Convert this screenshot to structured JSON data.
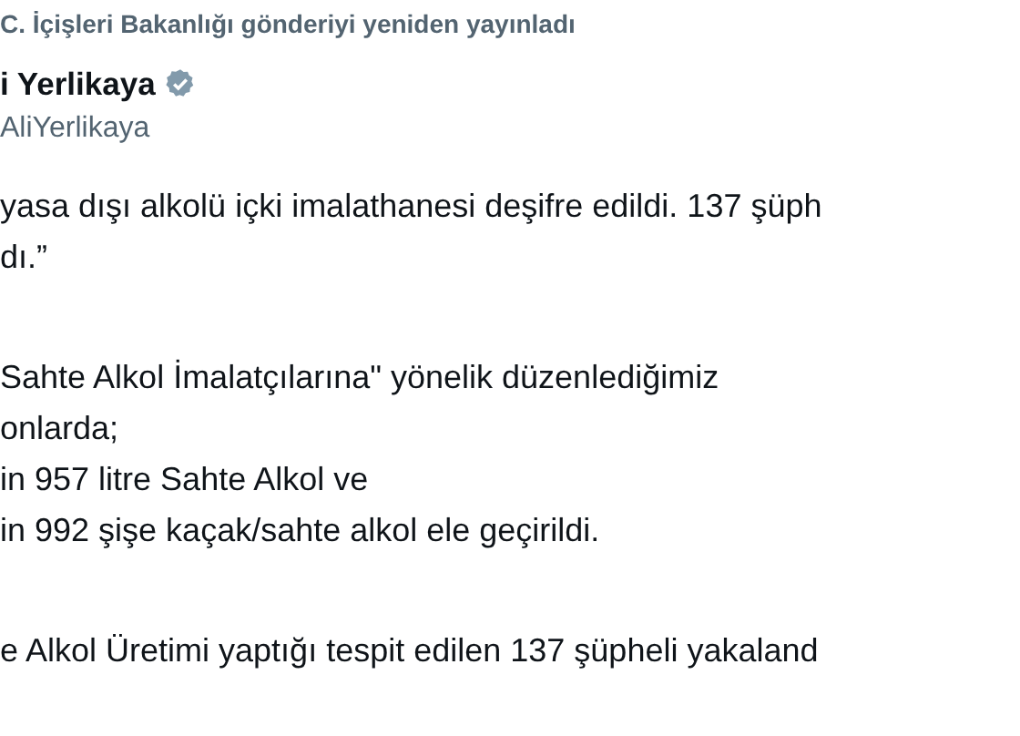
{
  "repost_label": "C. İçişleri Bakanlığı gönderiyi yeniden yayınladı",
  "author": {
    "name": "i Yerlikaya",
    "verified": true,
    "handle": "AliYerlikaya"
  },
  "post_lines": [
    {
      "text": "yasa dışı alkolü içki imalathanesi deşifre edildi. 137 şüph",
      "gap_before": false
    },
    {
      "text": "dı.”",
      "gap_before": false
    },
    {
      "text": "Sahte Alkol İmalatçılarına\" yönelik düzenlediğimiz",
      "gap_before": true
    },
    {
      "text": "onlarda;",
      "gap_before": false
    },
    {
      "text": "in 957 litre Sahte Alkol ve",
      "gap_before": false
    },
    {
      "text": "in 992 şişe kaçak/sahte alkol ele geçirildi.",
      "gap_before": false
    },
    {
      "text": "e Alkol Üretimi yaptığı tespit edilen 137 şüpheli yakaland",
      "gap_before": true
    }
  ]
}
